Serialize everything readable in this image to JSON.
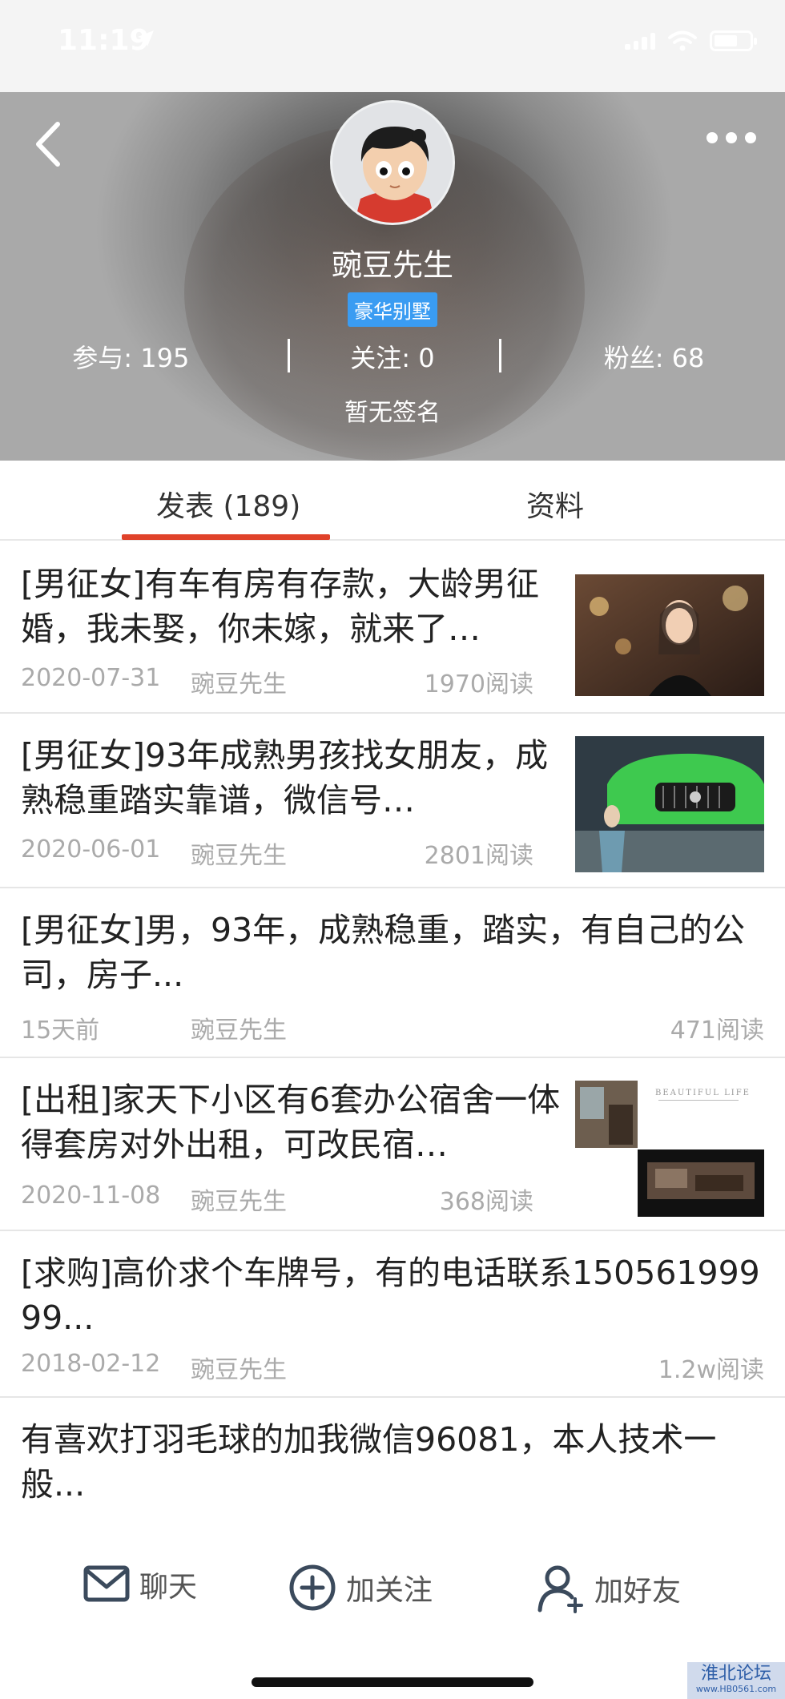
{
  "status_bar": {
    "time": "11:19"
  },
  "header": {
    "username": "豌豆先生",
    "badge": "豪华别墅",
    "stats": [
      {
        "label": "参与: 195"
      },
      {
        "label": "关注: 0"
      },
      {
        "label": "粉丝: 68"
      }
    ],
    "signature": "暂无签名"
  },
  "tabs": [
    {
      "label": "发表 (189)",
      "active": true
    },
    {
      "label": "资料",
      "active": false
    }
  ],
  "posts": [
    {
      "title": "[男征女]有车有房有存款，大龄男征婚，我未娶，你未嫁，就来了…",
      "date": "2020-07-31",
      "author": "豌豆先生",
      "reads": "1970阅读"
    },
    {
      "title": "[男征女]93年成熟男孩找女朋友，成熟稳重踏实靠谱，微信号…",
      "date": "2020-06-01",
      "author": "豌豆先生",
      "reads": "2801阅读"
    },
    {
      "title": "[男征女]男，93年，成熟稳重，踏实，有自己的公司，房子...",
      "date": "15天前",
      "author": "豌豆先生",
      "reads": "471阅读"
    },
    {
      "title": "[出租]家天下小区有6套办公宿舍一体得套房对外出租，可改民宿…",
      "date": "2020-11-08",
      "author": "豌豆先生",
      "reads": "368阅读",
      "thumb_caption": "BEAUTIFUL LIFE"
    },
    {
      "title": "[求购]高价求个车牌号，有的电话联系15056199999...",
      "date": "2018-02-12",
      "author": "豌豆先生",
      "reads": "1.2w阅读"
    },
    {
      "title": "有喜欢打羽毛球的加我微信96081，本人技术一般...",
      "date": "",
      "author": "",
      "reads": ""
    }
  ],
  "bottom_bar": {
    "chat": "聊天",
    "follow": "加关注",
    "add_friend": "加好友"
  },
  "watermark": {
    "text": "淮北论坛",
    "url_text": "www.HB0561.com"
  },
  "colors": {
    "accent": "#e0422a",
    "badge": "#3a9cf2"
  }
}
